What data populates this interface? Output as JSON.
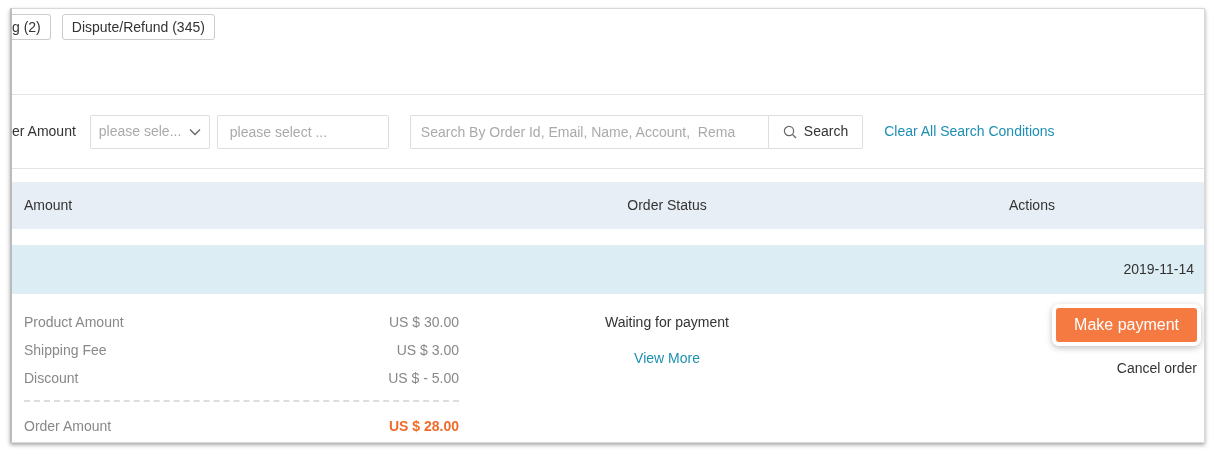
{
  "status_tabs": [
    {
      "label": "g (2)",
      "selected": false
    },
    {
      "label": "Dispute/Refund (345)",
      "selected": false
    }
  ],
  "filters": {
    "label": "er Amount",
    "select_placeholder": "please sele...",
    "input_placeholder": "please select ...",
    "search_placeholder": "Search By Order Id, Email, Name, Account,  Rema",
    "search_button": "Search",
    "clear_link": "Clear All Search Conditions"
  },
  "table": {
    "columns": [
      "Amount",
      "Order Status",
      "Actions"
    ],
    "orders": [
      {
        "date": "2019-11-14",
        "amounts": [
          {
            "label": "Product Amount",
            "value": "US $ 30.00"
          },
          {
            "label": "Shipping Fee",
            "value": "US $ 3.00"
          },
          {
            "label": "Discount",
            "value": "US $ - 5.00"
          }
        ],
        "total": {
          "label": "Order Amount",
          "value": "US $ 28.00"
        },
        "status": "Waiting for payment",
        "view_more": "View More",
        "primary_action": "Make payment",
        "secondary_action": "Cancel order"
      }
    ]
  }
}
